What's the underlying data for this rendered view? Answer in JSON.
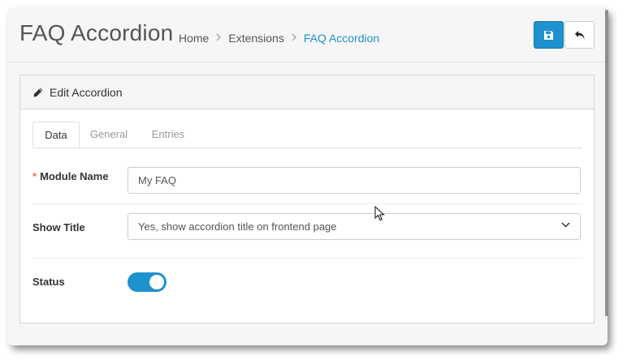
{
  "header": {
    "title": "FAQ Accordion",
    "breadcrumb": [
      "Home",
      "Extensions",
      "FAQ Accordion"
    ],
    "breadcrumb_separator": ">",
    "save_icon": "save-icon",
    "back_icon": "reply-icon"
  },
  "panel": {
    "title": "Edit Accordion",
    "icon": "pencil-icon"
  },
  "tabs": [
    {
      "label": "Data",
      "active": true
    },
    {
      "label": "General",
      "active": false
    },
    {
      "label": "Entries",
      "active": false
    }
  ],
  "form": {
    "module_name": {
      "required_mark": "*",
      "label": "Module Name",
      "value": "My FAQ"
    },
    "show_title": {
      "label": "Show Title",
      "value": "Yes, show accordion title on frontend page"
    },
    "status": {
      "label": "Status",
      "enabled": true
    }
  },
  "colors": {
    "primary": "#1e91cf",
    "required": "#f56b6b"
  }
}
